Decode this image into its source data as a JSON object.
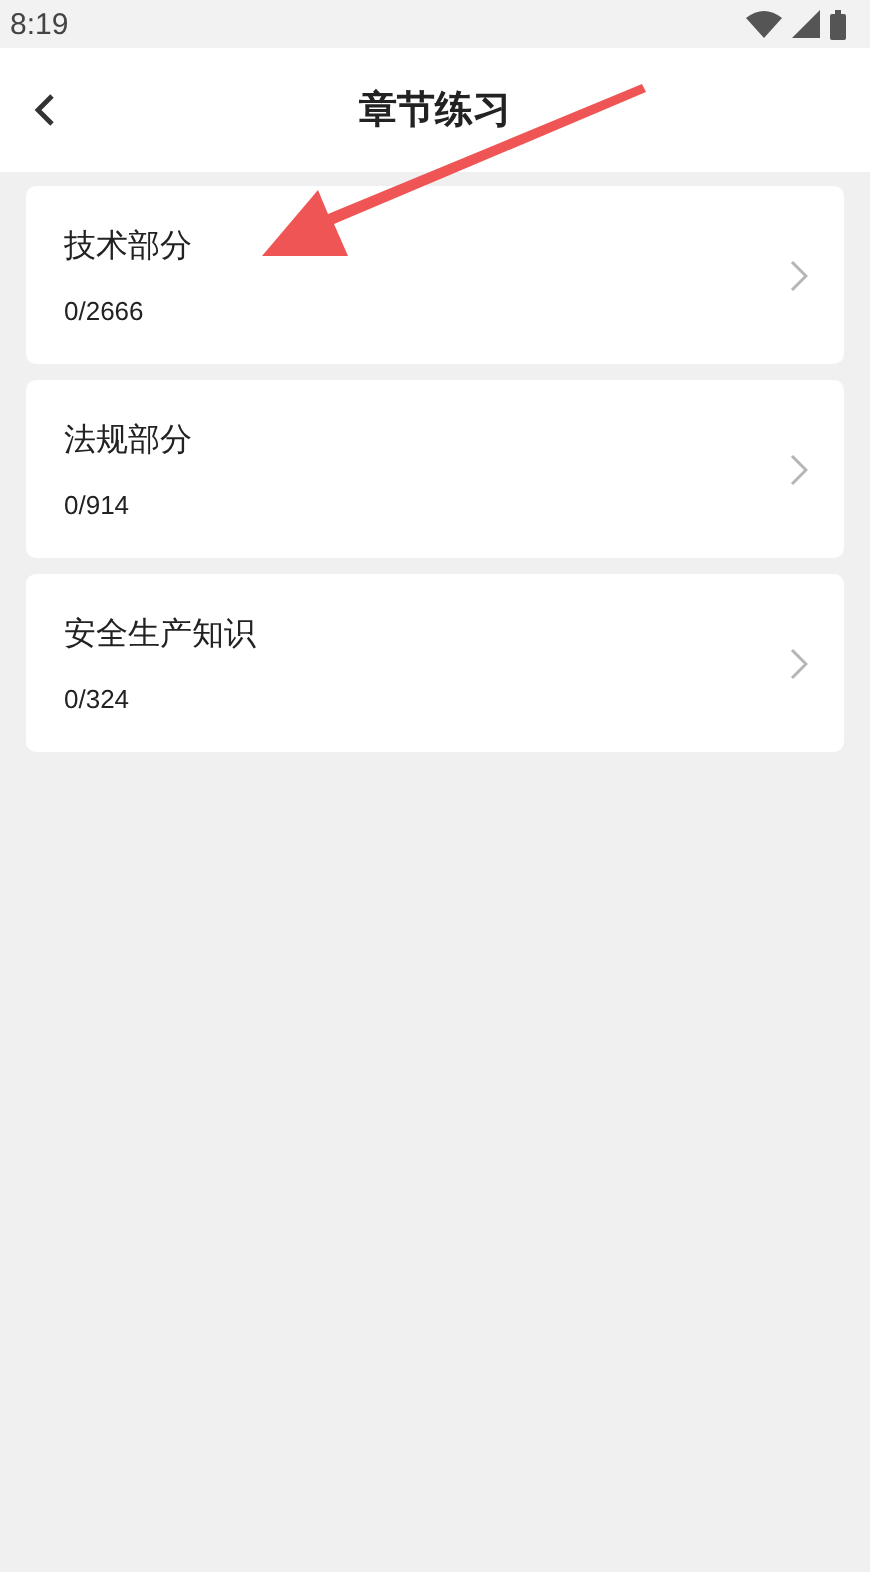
{
  "status_bar": {
    "time": "8:19"
  },
  "header": {
    "title": "章节练习"
  },
  "chapters": [
    {
      "name": "技术部分",
      "progress": "0/2666"
    },
    {
      "name": "法规部分",
      "progress": "0/914"
    },
    {
      "name": "安全生产知识",
      "progress": "0/324"
    }
  ]
}
